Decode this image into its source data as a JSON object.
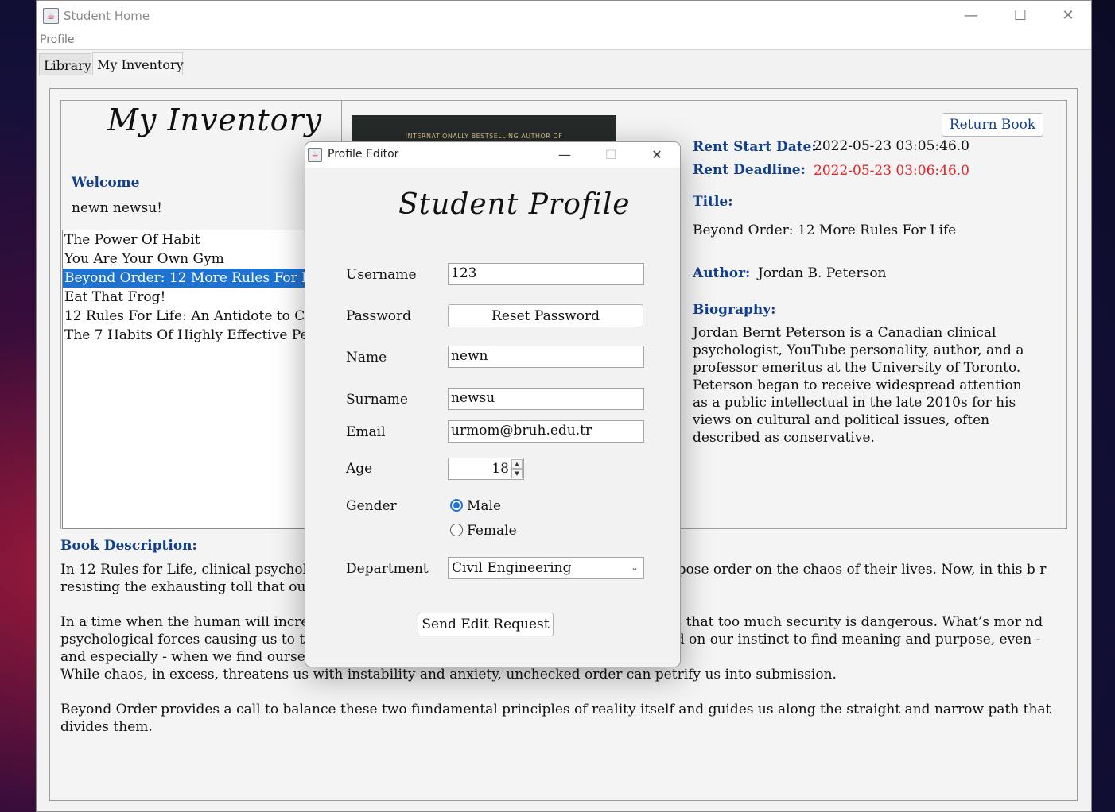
{
  "window": {
    "title": "Student Home",
    "icon": "java-icon",
    "controls": {
      "minimize": "—",
      "maximize": "☐",
      "close": "✕"
    }
  },
  "menubar": {
    "items": [
      "Profile"
    ]
  },
  "tabs": [
    {
      "label": "Library",
      "active": false
    },
    {
      "label": "My Inventory",
      "active": true
    }
  ],
  "inventory": {
    "heading": "My Inventory",
    "welcome_label": "Welcome",
    "user_name": "newn newsu!",
    "books": [
      {
        "title": "The Power Of Habit",
        "selected": false
      },
      {
        "title": "You Are Your Own Gym",
        "selected": false
      },
      {
        "title": "Beyond Order: 12 More Rules For Life",
        "selected": true
      },
      {
        "title": "Eat That Frog!",
        "selected": false
      },
      {
        "title": "12 Rules For Life: An Antidote to Chaos",
        "selected": false
      },
      {
        "title": "The 7 Habits Of Highly Effective People",
        "selected": false
      }
    ]
  },
  "details": {
    "cover_text": "INTERNATIONALLY BESTSELLING AUTHOR OF",
    "return_button": "Return Book",
    "rent_start_label": "Rent Start Date:",
    "rent_start_value": "2022-05-23 03:05:46.0",
    "rent_deadline_label": "Rent Deadline:",
    "rent_deadline_value": "2022-05-23 03:06:46.0",
    "title_label": "Title:",
    "title_value": "Beyond Order: 12 More Rules For Life",
    "author_label": "Author:",
    "author_value": "Jordan B. Peterson",
    "biography_label": "Biography:",
    "biography": "Jordan Bernt Peterson is a Canadian clinical psychologist, YouTube personality, author, and a professor emeritus at the University of Toronto. Peterson began to receive widespread attention as a public intellectual in the late 2010s for his views on cultural and political issues, often described as conservative.",
    "description_label": "Book Description:",
    "description": [
      "In 12 Rules for Life, clinical psychologist                                                                        oronto Dr. Jordan B. Peterson helped millions impose order on the chaos of their lives. Now, in this b                                                                           r resisting the exhausting toll that our desire to order the world inevitably takes.",
      "In a time when the human will increasin                                                                          ructures to our emotional states - Peterson warns that too much security is dangerous. What’s mor                                                                          nd psychological forces causing us to tend toward tyranny, and teaches us how to rely instead on our instinct to find meaning and purpose, even - and especially - when we find ourselves powerless.",
      "While chaos, in excess, threatens us with instability and anxiety, unchecked order can petrify us into submission.",
      "Beyond Order provides a call to balance these two fundamental principles of reality itself and guides us along the straight and narrow path that divides them."
    ]
  },
  "dialog": {
    "title": "Profile Editor",
    "heading": "Student Profile",
    "controls": {
      "minimize": "—",
      "maximize": "☐",
      "close": "✕"
    },
    "username_label": "Username",
    "username_value": "123",
    "password_label": "Password",
    "reset_password_button": "Reset Password",
    "name_label": "Name",
    "name_value": "newn",
    "surname_label": "Surname",
    "surname_value": "newsu",
    "email_label": "Email",
    "email_value": "urmom@bruh.edu.tr",
    "age_label": "Age",
    "age_value": "18",
    "gender_label": "Gender",
    "gender_options": [
      "Male",
      "Female"
    ],
    "gender_selected": "Male",
    "department_label": "Department",
    "department_value": "Civil Engineering",
    "submit_button": "Send Edit Request"
  },
  "colors": {
    "accent_blue": "#123f8c",
    "selection": "#1e73d2",
    "deadline_red": "#e0242a"
  }
}
